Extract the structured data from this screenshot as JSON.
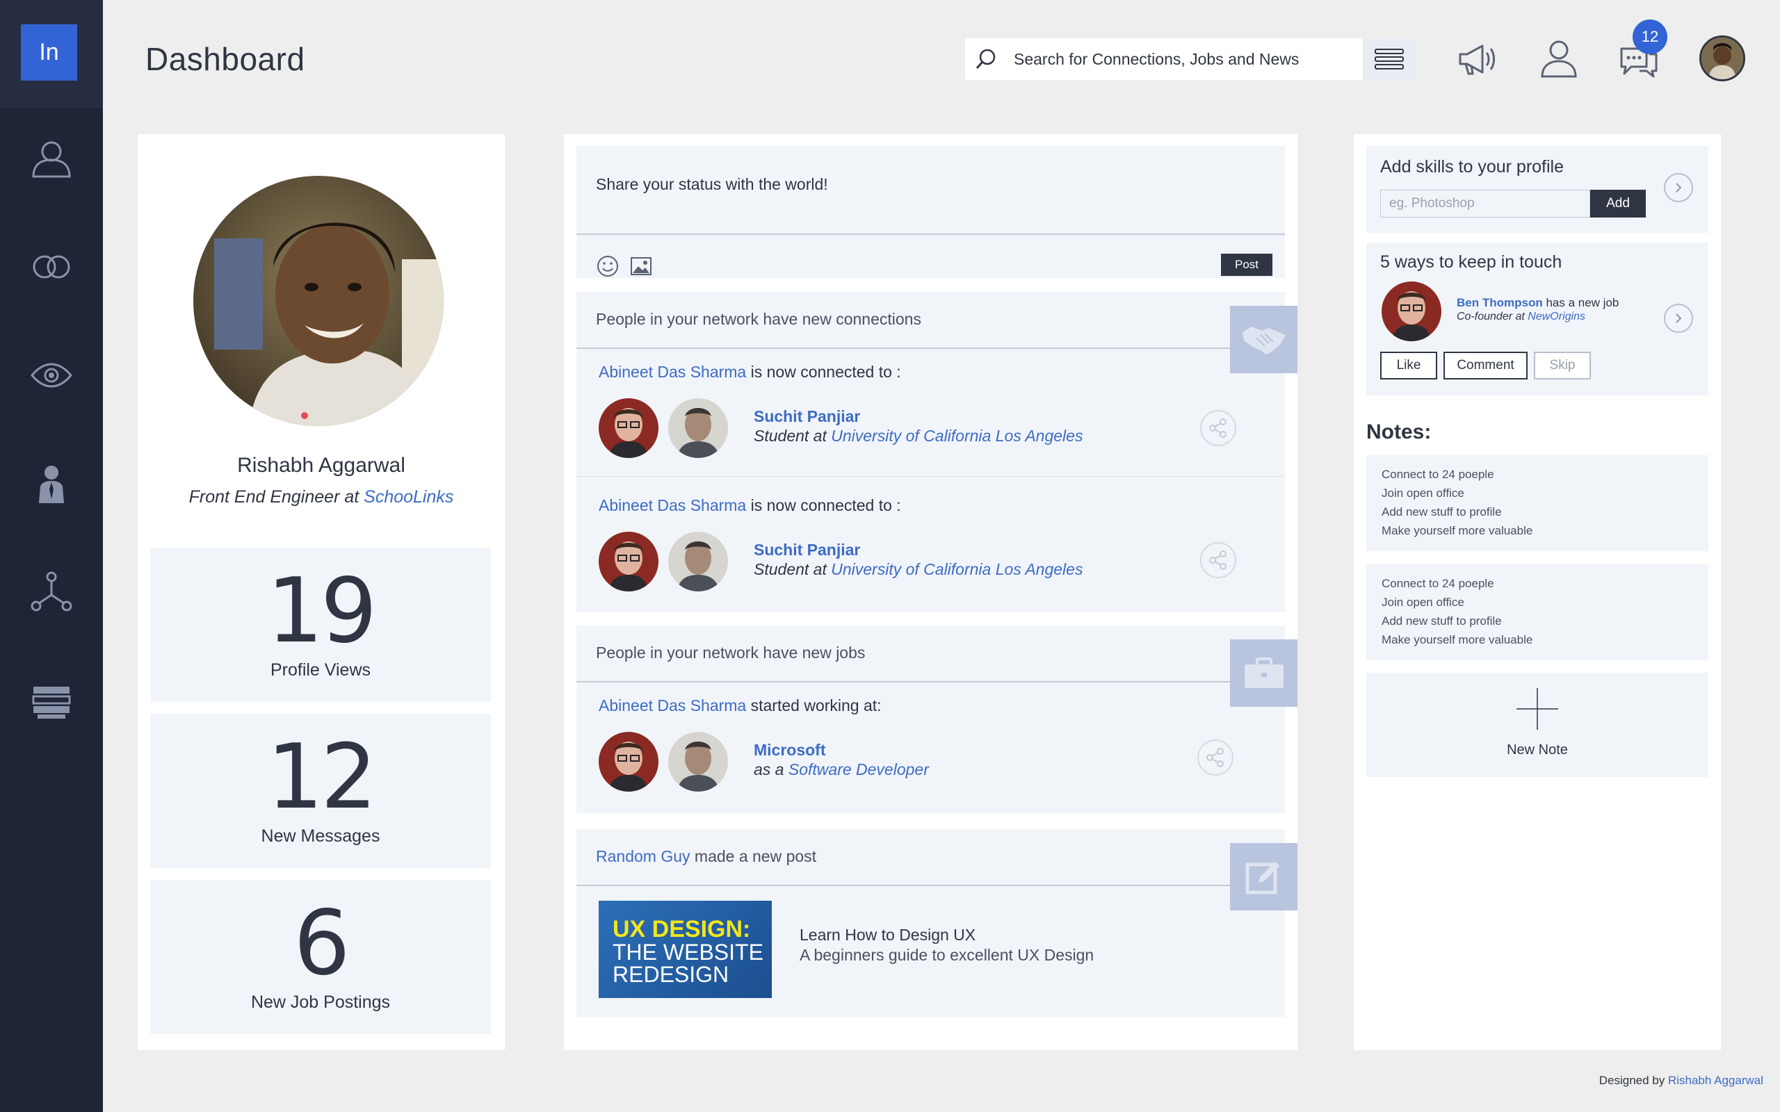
{
  "brand": {
    "logo": "In",
    "accent": "#3364d6",
    "sidebar_bg": "#1f2436"
  },
  "sidebar": {
    "items": [
      {
        "icon": "user-icon"
      },
      {
        "icon": "rings-icon"
      },
      {
        "icon": "eye-icon"
      },
      {
        "icon": "business-person-icon"
      },
      {
        "icon": "network-icon"
      },
      {
        "icon": "books-icon"
      }
    ]
  },
  "header": {
    "title": "Dashboard",
    "search_placeholder": "Search for Connections, Jobs and News",
    "messages_badge": "12"
  },
  "profile": {
    "name": "Rishabh Aggarwal",
    "role_prefix": "Front End Engineer at ",
    "company": "SchooLinks",
    "stats": [
      {
        "value": "19",
        "label": "Profile Views"
      },
      {
        "value": "12",
        "label": "New Messages"
      },
      {
        "value": "6",
        "label": "New Job Postings"
      }
    ]
  },
  "status": {
    "placeholder": "Share your status with the world!",
    "post_label": "Post"
  },
  "feed": {
    "connections": {
      "heading": "People in your network  have new connections",
      "items": [
        {
          "actor": "Abineet Das Sharma",
          "action": " is now connected to :",
          "name": "Suchit Panjiar",
          "sub_prefix": "Student at ",
          "sub_link": "University of California Los Angeles"
        },
        {
          "actor": "Abineet Das Sharma",
          "action": " is now connected to :",
          "name": "Suchit Panjiar",
          "sub_prefix": "Student at ",
          "sub_link": "University of California Los Angeles"
        }
      ]
    },
    "jobs": {
      "heading": "People in your network  have new jobs",
      "actor": "Abineet Das Sharma",
      "action": " started working at:",
      "company": "Microsoft",
      "sub_prefix": "as a ",
      "sub_link": "Software Developer"
    },
    "post": {
      "actor": "Random Guy",
      "action": " made a new post",
      "thumb_line1": "UX DESIGN:",
      "thumb_line2": "THE WEBSITE",
      "thumb_line3": "REDESIGN",
      "title": "Learn How to Design UX",
      "subtitle": "A beginners guide to excellent UX Design"
    }
  },
  "right": {
    "skills": {
      "title": "Add skills to your profile",
      "placeholder": "eg. Photoshop",
      "add_label": "Add"
    },
    "keep_in_touch": {
      "title": "5 ways to keep in touch",
      "person": "Ben Thompson",
      "event": " has a new job",
      "role_prefix": "Co-founder at ",
      "company": "NewOrigins",
      "like": "Like",
      "comment": "Comment",
      "skip": "Skip"
    },
    "notes_heading": "Notes:",
    "notes": [
      [
        "Connect to 24 poeple",
        "Join open office",
        "Add new stuff to profile",
        "Make yourself more valuable"
      ],
      [
        "Connect to 24 poeple",
        "Join open office",
        "Add new stuff to profile",
        "Make yourself more valuable"
      ]
    ],
    "new_note_label": "New Note"
  },
  "footer": {
    "prefix": "Designed by ",
    "author": "Rishabh Aggarwal"
  }
}
